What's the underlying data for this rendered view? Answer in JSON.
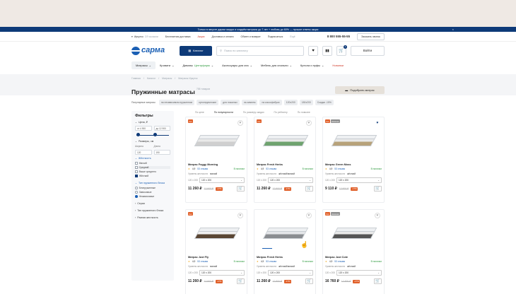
{
  "promo": {
    "text": "Только в августе дарим скидки и создаём матрасы до 7 лет + любовь до 60% — лучшие ответы акции",
    "close": "×"
  },
  "topbar": {
    "city": "Иркутск",
    "city_sub": "Сб·сызыми",
    "links": [
      "Бесплатная доставка",
      "Акции",
      "Доставка и оплата",
      "Обмен и возврат",
      "Подписаться"
    ],
    "more": "Ещё",
    "phone": "8 800 555-55-55",
    "call_btn": "Заказать звонок"
  },
  "header": {
    "logo": "сарма",
    "catalog": "Каталог",
    "search_placeholder": "Поиск по каталогу",
    "cart_count": "1",
    "login": "Войти"
  },
  "nav": [
    {
      "label": "Матрасы",
      "active": true,
      "style": ""
    },
    {
      "label": "Кровати",
      "style": ""
    },
    {
      "label": "Диваны",
      "extra": "Центрфарм",
      "style": ""
    },
    {
      "label": "Аксессуары для сна",
      "style": ""
    },
    {
      "label": "Мебель для спальни",
      "style": ""
    },
    {
      "label": "Кресла и пуфы",
      "style": ""
    },
    {
      "label": "Новинки",
      "style": "red"
    }
  ],
  "breadcrumbs": [
    "Главная",
    "Каталог",
    "Матрасы",
    "Матрасы Иркутск"
  ],
  "title": "Пружинные матрасы",
  "count": "758 товаров",
  "pick_button": "Подобрать матрас",
  "popular": {
    "label": "Популярные запросы",
    "chips": [
      "на независимом пружинном",
      "ортопедические",
      "для пожилых",
      "на зимнем",
      "на кокосфибрах",
      "120х200",
      "180х200",
      "Скидки -15%"
    ]
  },
  "filters": {
    "title": "Фильтры",
    "price_label": "Цена, ₽",
    "price_from": "от 4 900",
    "price_to": "до 12 900",
    "size_label": "Размеры, см",
    "width_label": "Ширина",
    "length_label": "Длина",
    "width_val": "120",
    "length_val": "190",
    "hardness_label": "Жёсткость",
    "hardness": [
      {
        "label": "Мягкий",
        "on": false
      },
      {
        "label": "Средний",
        "on": false,
        "sel": true
      },
      {
        "label": "Выше среднего",
        "on": false
      },
      {
        "label": "Жёсткий",
        "on": true
      }
    ],
    "spring_label": "Тип пружинного блока",
    "spring": [
      {
        "label": "Беспружинные",
        "on": false
      },
      {
        "label": "Зависимые",
        "on": false
      },
      {
        "label": "Независимые",
        "on": true
      }
    ],
    "more": [
      "Серии",
      "Тип пружинного блока",
      "Разная жесткость"
    ]
  },
  "sorts": [
    "По цене",
    "По популярности",
    "По размеру скидки",
    "По рейтингу",
    "По новизне"
  ],
  "products": [
    {
      "name": "Матрас Foggy Morning",
      "rating": "4,9",
      "reviews": "53 отзыва",
      "stock": "В наличии",
      "hardness": "мягкий",
      "size": "120 х 200",
      "price": "11 260 ₽",
      "old": "12 900 ₽",
      "disc": "-17%",
      "badges": [
        "Хит"
      ],
      "fav": false,
      "colors": [
        "#e9e9e9",
        "#cfcfcf"
      ]
    },
    {
      "name": "Матрас Fresh Herbs",
      "rating": "4,9",
      "reviews": "53 отзыва",
      "stock": "В наличии",
      "hardness": "жёсткий/мягкий",
      "size": "120 х 200",
      "price": "11 260 ₽",
      "old": "12 900 ₽",
      "disc": "-17%",
      "badges": [
        "Хит"
      ],
      "fav": false,
      "colors": [
        "#e9e9e9",
        "#6fa36f"
      ]
    },
    {
      "name": "Матрас Green Moss",
      "rating": "4,9",
      "reviews": "53 отзыва",
      "stock": "В наличии",
      "hardness": "жёсткий",
      "size": "120 х 200",
      "price": "9 110 ₽",
      "old": "12 900 ₽",
      "disc": "-17%",
      "badges": [
        "Хит",
        "Новинка"
      ],
      "fav": true,
      "colors": [
        "#e9e9e9",
        "#b7a27a"
      ]
    },
    {
      "name": "Матрас Just Fly",
      "rating": "4,9",
      "reviews": "53 отзыва",
      "stock": "В наличии",
      "hardness": "мягкий",
      "size": "120 х 200",
      "price": "11 260 ₽",
      "old": "12 900 ₽",
      "disc": "-17%",
      "badges": [
        "Хит"
      ],
      "fav": false,
      "colors": [
        "#f0f0f0",
        "#5a4634"
      ]
    },
    {
      "name": "Матрас Fresh Herbs",
      "rating": "4,9",
      "reviews": "53 отзыва",
      "stock": "В наличии",
      "hardness": "жёсткий/мягкий",
      "size": "120 х 200",
      "price": "11 260 ₽",
      "old": "12 900 ₽",
      "disc": "-17%",
      "badges": [],
      "fav": false,
      "colors": [
        "#e4e6e9",
        "#8a8d91"
      ]
    },
    {
      "name": "Матрас Just Cote",
      "rating": "4,9",
      "reviews": "53 отзыва",
      "stock": "В наличии",
      "hardness": "жёсткий",
      "size": "120 х 200",
      "price": "16 760 ₽",
      "old": "12 900 ₽",
      "disc": "-17%",
      "badges": [
        "Хит",
        "Новинка"
      ],
      "fav": false,
      "colors": [
        "#e9e9e9",
        "#555"
      ]
    }
  ],
  "product_labels": {
    "hardness_prefix": "Уровень жесткости",
    "size_prefix": "120 х 200"
  }
}
